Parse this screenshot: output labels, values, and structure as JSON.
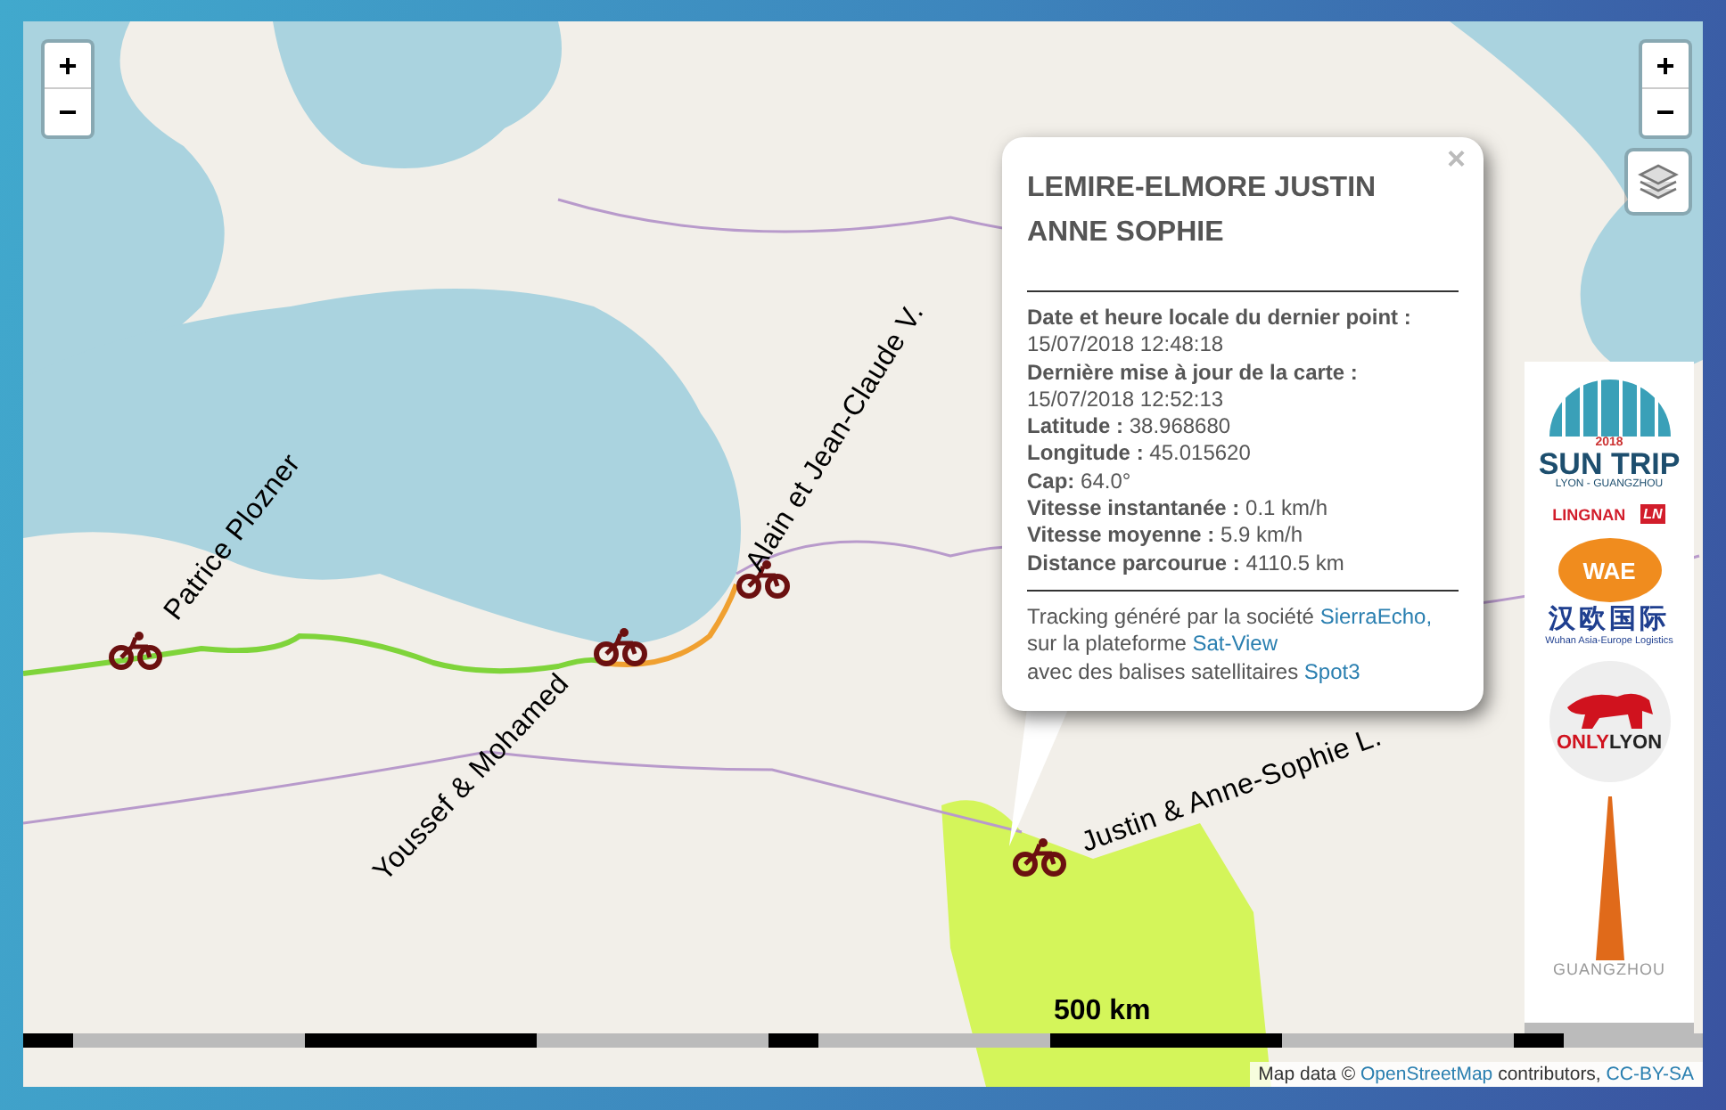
{
  "zoom_controls": [
    {
      "buttons": [
        "+",
        "−"
      ]
    },
    {
      "buttons": [
        "+",
        "−"
      ]
    }
  ],
  "markers": [
    {
      "label": "Patrice Plozner"
    },
    {
      "label": "Youssef & Mohamed"
    },
    {
      "label": "Alain et Jean-Claude V."
    },
    {
      "label": "Justin & Anne-Sophie L."
    }
  ],
  "popup": {
    "close": "×",
    "title": "LEMIRE-ELMORE JUSTIN ANNE SOPHIE",
    "fields": [
      {
        "kind": "stacked",
        "label": "Date et heure locale du dernier point :",
        "value": "15/07/2018 12:48:18"
      },
      {
        "kind": "stacked",
        "label": "Dernière mise à jour de la carte :",
        "value": "15/07/2018 12:52:13"
      },
      {
        "kind": "inline",
        "label": "Latitude :",
        "value": "38.968680"
      },
      {
        "kind": "inline",
        "label": "Longitude :",
        "value": "45.015620"
      },
      {
        "kind": "inline",
        "label": "Cap:",
        "value": "64.0°"
      },
      {
        "kind": "inline",
        "label": "Vitesse instantanée :",
        "value": "0.1 km/h"
      },
      {
        "kind": "inline",
        "label": "Vitesse moyenne :",
        "value": "5.9 km/h"
      },
      {
        "kind": "inline",
        "label": "Distance parcourue :",
        "value": "4110.5 km"
      }
    ],
    "credits": [
      {
        "text": "Tracking généré par la société",
        "link": "SierraEcho,"
      },
      {
        "text": "sur la plateforme",
        "link": "Sat-View"
      },
      {
        "text": "avec des balises satellitaires",
        "link": "Spot3"
      }
    ]
  },
  "sponsors": [
    {
      "kind": "suntrip",
      "year": "2018",
      "title": "SUN TRIP",
      "subtitle": "LYON - GUANGZHOU"
    },
    {
      "kind": "lingnan",
      "title": "LINGNAN",
      "badge": "LN"
    },
    {
      "kind": "wae",
      "title": "WAE",
      "chinese": "汉欧国际",
      "subtitle": "Wuhan Asia-Europe Logistics"
    },
    {
      "kind": "onlylyon",
      "first": "ONLY",
      "second": "LYON"
    },
    {
      "kind": "guangzhou",
      "title": "GUANGZHOU"
    }
  ],
  "scale": {
    "label": "500 km"
  },
  "attribution": {
    "prefix": "Map data ©",
    "link": "OpenStreetMap",
    "middle": "contributors,",
    "license": "CC-BY-SA"
  }
}
